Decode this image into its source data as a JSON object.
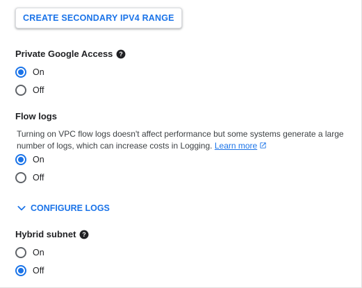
{
  "secondary_range_button": "CREATE SECONDARY IPV4 RANGE",
  "private_google_access": {
    "title": "Private Google Access",
    "options": [
      {
        "label": "On",
        "selected": true
      },
      {
        "label": "Off",
        "selected": false
      }
    ]
  },
  "flow_logs": {
    "title": "Flow logs",
    "description": "Turning on VPC flow logs doesn't affect performance but some systems generate a large number of logs, which can increase costs in Logging.",
    "learn_more": "Learn more",
    "options": [
      {
        "label": "On",
        "selected": true
      },
      {
        "label": "Off",
        "selected": false
      }
    ]
  },
  "configure_logs": "CONFIGURE LOGS",
  "hybrid_subnet": {
    "title": "Hybrid subnet",
    "options": [
      {
        "label": "On",
        "selected": false
      },
      {
        "label": "Off",
        "selected": true
      }
    ]
  },
  "colors": {
    "accent": "#1a73e8",
    "text": "#202124",
    "radio_unselected": "#5f6368"
  },
  "icons": {
    "help": "help-circle-icon",
    "external": "open-in-new-icon",
    "chevron": "chevron-down-icon"
  }
}
